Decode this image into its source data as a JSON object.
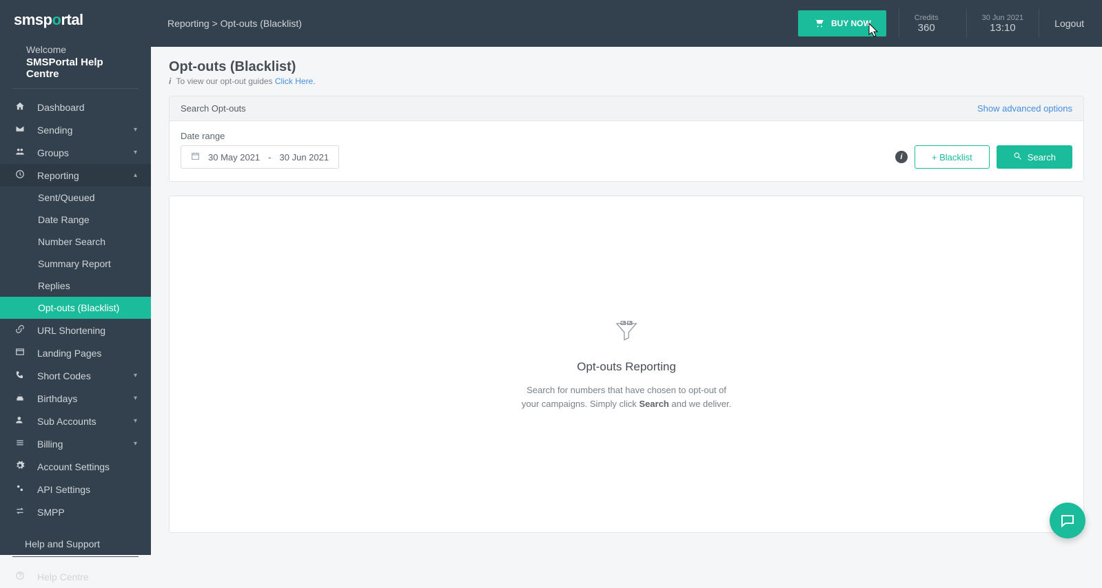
{
  "logo": {
    "pre": "smsp",
    "accent": "o",
    "post": "rtal"
  },
  "welcome": {
    "label": "Welcome",
    "name": "SMSPortal Help Centre"
  },
  "sidebar": {
    "items": [
      {
        "label": "Dashboard"
      },
      {
        "label": "Sending"
      },
      {
        "label": "Groups"
      },
      {
        "label": "Reporting"
      },
      {
        "label": "URL Shortening"
      },
      {
        "label": "Landing Pages"
      },
      {
        "label": "Short Codes"
      },
      {
        "label": "Birthdays"
      },
      {
        "label": "Sub Accounts"
      },
      {
        "label": "Billing"
      },
      {
        "label": "Account Settings"
      },
      {
        "label": "API Settings"
      },
      {
        "label": "SMPP"
      }
    ],
    "reporting_sub": [
      {
        "label": "Sent/Queued"
      },
      {
        "label": "Date Range"
      },
      {
        "label": "Number Search"
      },
      {
        "label": "Summary Report"
      },
      {
        "label": "Replies"
      },
      {
        "label": "Opt-outs (Blacklist)"
      }
    ],
    "help_heading": "Help and Support",
    "help_items": [
      {
        "label": "Help Centre"
      }
    ]
  },
  "topbar": {
    "breadcrumb": "Reporting > Opt-outs (Blacklist)",
    "buy_now": "BUY NOW",
    "credits_label": "Credits",
    "credits_value": "360",
    "date_label": "30 Jun 2021",
    "time_value": "13:10",
    "logout": "Logout"
  },
  "page": {
    "title": "Opt-outs (Blacklist)",
    "sub_prefix": "To view our opt-out guides ",
    "sub_link": "Click Here."
  },
  "search_panel": {
    "header": "Search Opt-outs",
    "advanced": "Show advanced options",
    "date_range_label": "Date range",
    "date_from": "30 May 2021",
    "date_to": "30 Jun 2021",
    "blacklist_btn": "+ Blacklist",
    "search_btn": "Search"
  },
  "empty": {
    "title": "Opt-outs Reporting",
    "line1_a": "Search for numbers that have chosen to opt-out of",
    "line2_a": "your campaigns. Simply click ",
    "line2_strong": "Search",
    "line2_b": " and we deliver."
  },
  "icons": {
    "home": "⌂",
    "send": "✉",
    "groups": "👥",
    "reporting": "✪",
    "link": "🔗",
    "landing": "▭",
    "shortcodes": "✎",
    "birthdays": "🎂",
    "sub": "👤",
    "billing": "☰",
    "settings": "⚙",
    "api": "⚙",
    "smpp": "⇄",
    "help": "?"
  }
}
